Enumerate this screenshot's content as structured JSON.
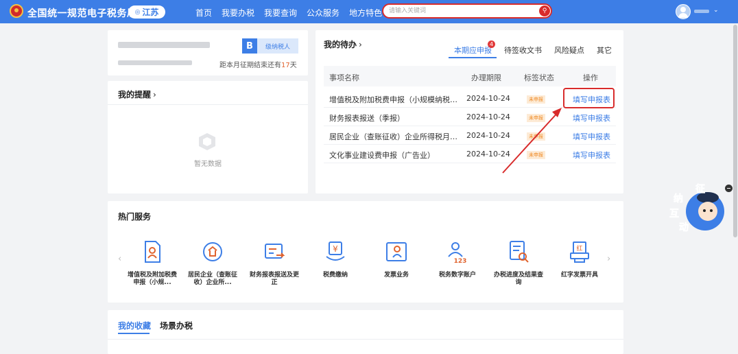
{
  "header": {
    "site_title": "全国统一规范电子税务局",
    "region": "江苏",
    "nav": [
      "首页",
      "我要办税",
      "我要查询",
      "公众服务",
      "地方特色"
    ],
    "search_placeholder": "请输入关键词"
  },
  "taxpayer_card": {
    "badge_letter": "B",
    "badge_level": "级纳税人",
    "period_prefix": "距本月征期结束还有",
    "period_days": "17",
    "period_suffix": "天"
  },
  "reminders": {
    "title": "我的提醒",
    "empty_text": "暂无数据"
  },
  "todo": {
    "title": "我的待办",
    "tabs": [
      "本期应申报",
      "待签收文书",
      "风险疑点",
      "其它"
    ],
    "active_tab_badge": "4",
    "columns": [
      "事项名称",
      "办理期限",
      "标签状态",
      "操作"
    ],
    "rows": [
      {
        "name": "增值税及附加税费申报（小规模纳税人）",
        "deadline": "2024-10-24",
        "status": "未申报",
        "action": "填写申报表"
      },
      {
        "name": "财务报表报送（季报）",
        "deadline": "2024-10-24",
        "status": "未申报",
        "action": "填写申报表"
      },
      {
        "name": "居民企业（查账征收）企业所得税月（...",
        "deadline": "2024-10-24",
        "status": "未申报",
        "action": "填写申报表"
      },
      {
        "name": "文化事业建设费申报（广告业）",
        "deadline": "2024-10-24",
        "status": "未申报",
        "action": "填写申报表"
      }
    ]
  },
  "hot_services": {
    "title": "热门服务",
    "items": [
      {
        "label": "增值税及附加税费申报（小规...",
        "icon": "tax-declaration-icon"
      },
      {
        "label": "居民企业（查账征收）企业所...",
        "icon": "enterprise-tax-icon"
      },
      {
        "label": "财务报表报送及更正",
        "icon": "financial-report-icon"
      },
      {
        "label": "税费缴纳",
        "icon": "tax-payment-icon"
      },
      {
        "label": "发票业务",
        "icon": "invoice-icon"
      },
      {
        "label": "税务数字账户",
        "icon": "digital-account-icon"
      },
      {
        "label": "办税进度及结果查询",
        "icon": "progress-query-icon"
      },
      {
        "label": "红字发票开具",
        "icon": "red-invoice-icon"
      }
    ],
    "red_invoice_glyph": "红",
    "account_digits": "123",
    "payment_glyph": "¥"
  },
  "favorites": {
    "tabs": [
      "我的收藏",
      "场景办税"
    ]
  },
  "float_widget": {
    "chars": [
      "征",
      "纳",
      "互",
      "动"
    ]
  },
  "colors": {
    "primary": "#3d7ee6",
    "highlight": "#d82b2b",
    "warning": "#f08a24"
  }
}
